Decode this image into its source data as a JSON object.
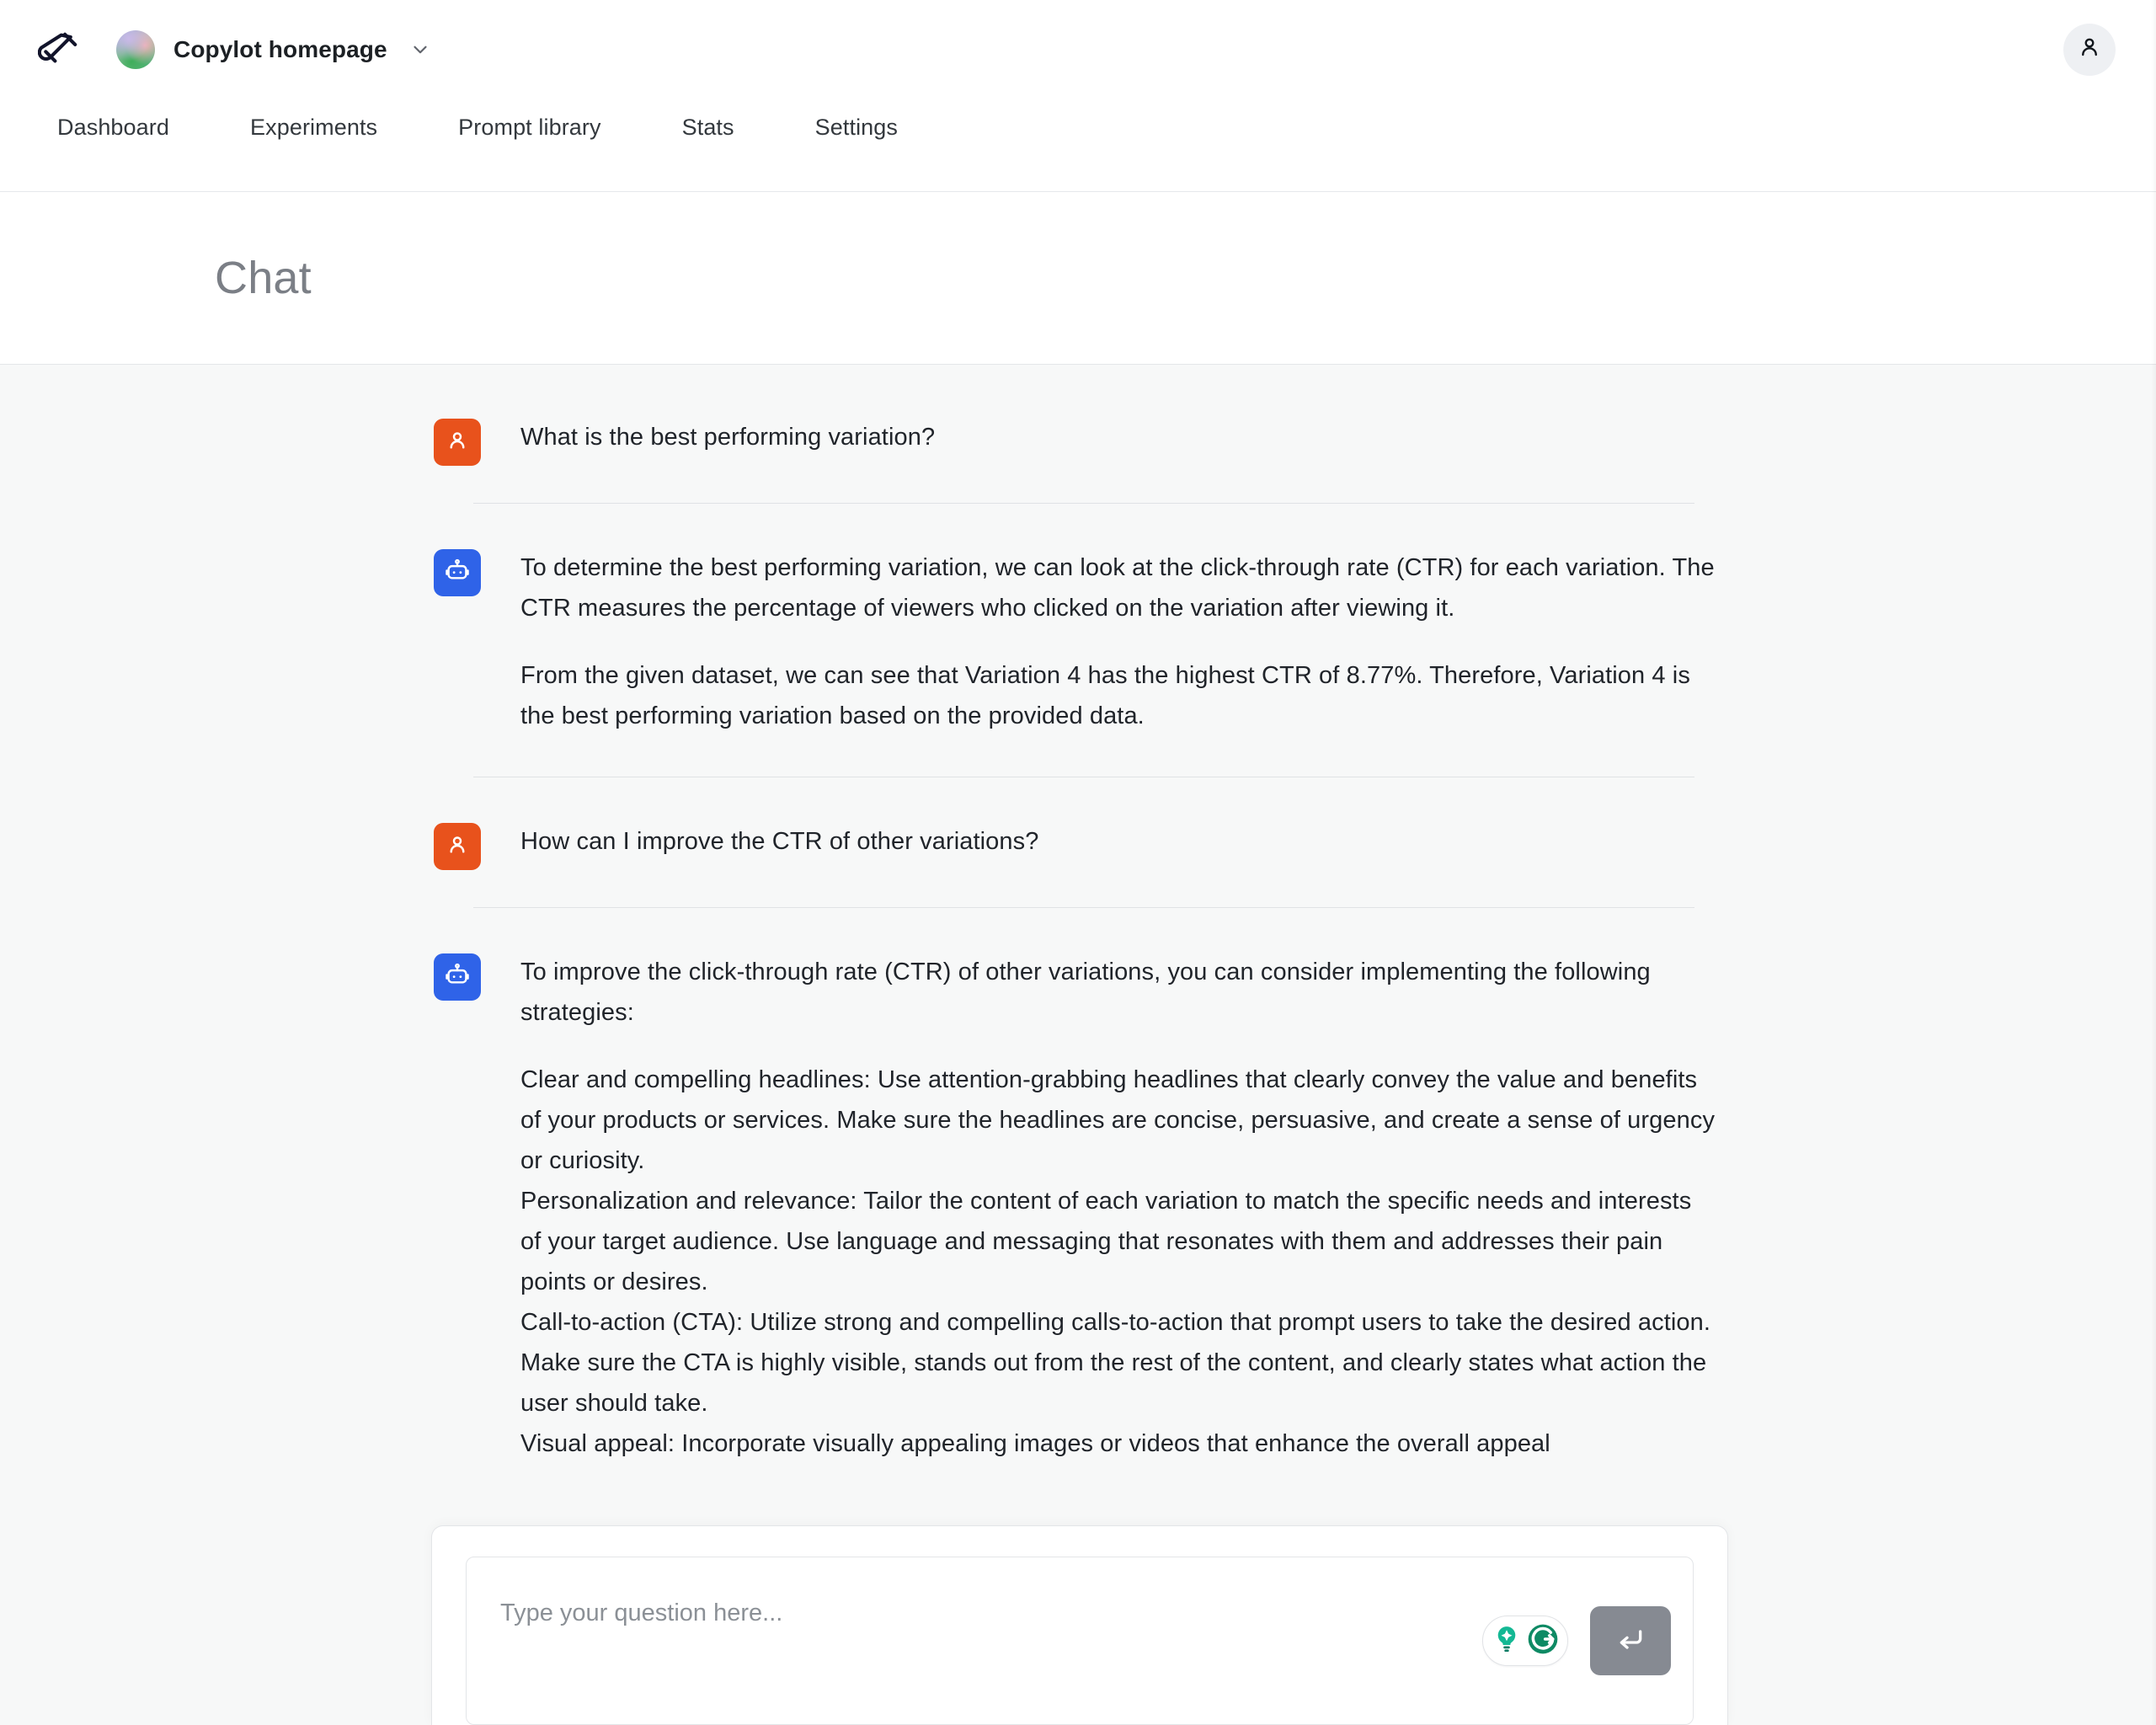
{
  "topbar": {
    "logo_icon": "test-tube-icon",
    "project_name": "Copylot homepage",
    "project_chevron_icon": "chevron-down-icon",
    "account_icon": "person-icon"
  },
  "nav": {
    "items": [
      {
        "label": "Dashboard"
      },
      {
        "label": "Experiments"
      },
      {
        "label": "Prompt library"
      },
      {
        "label": "Stats"
      },
      {
        "label": "Settings"
      }
    ]
  },
  "page": {
    "title": "Chat"
  },
  "chat": {
    "messages": [
      {
        "role": "user",
        "avatar_icon": "person-icon",
        "avatar_color": "#e8521c",
        "paragraphs": [
          "What is the best performing variation?"
        ]
      },
      {
        "role": "assistant",
        "avatar_icon": "robot-icon",
        "avatar_color": "#2f63e8",
        "paragraphs": [
          "To determine the best performing variation, we can look at the click-through rate (CTR) for each variation. The CTR measures the percentage of viewers who clicked on the variation after viewing it.",
          "From the given dataset, we can see that Variation 4 has the highest CTR of 8.77%. Therefore, Variation 4 is the best performing variation based on the provided data."
        ]
      },
      {
        "role": "user",
        "avatar_icon": "person-icon",
        "avatar_color": "#e8521c",
        "paragraphs": [
          "How can I improve the CTR of other variations?"
        ]
      },
      {
        "role": "assistant",
        "avatar_icon": "robot-icon",
        "avatar_color": "#2f63e8",
        "paragraphs": [
          "To improve the click-through rate (CTR) of other variations, you can consider implementing the following strategies:"
        ],
        "strategies": [
          "Clear and compelling headlines: Use attention-grabbing headlines that clearly convey the value and benefits of your products or services. Make sure the headlines are concise, persuasive, and create a sense of urgency or curiosity.",
          "Personalization and relevance: Tailor the content of each variation to match the specific needs and interests of your target audience. Use language and messaging that resonates with them and addresses their pain points or desires.",
          "Call-to-action (CTA): Utilize strong and compelling calls-to-action that prompt users to take the desired action. Make sure the CTA is highly visible, stands out from the rest of the content, and clearly states what action the user should take.",
          "Visual appeal: Incorporate visually appealing images or videos that enhance the overall appeal"
        ]
      }
    ]
  },
  "composer": {
    "placeholder": "Type your question here...",
    "value": "",
    "assist_lightbulb_icon": "lightbulb-sparkle-icon",
    "assist_grammarly_icon": "grammarly-g-icon",
    "send_icon": "enter-return-arrow-icon"
  },
  "colors": {
    "user_avatar": "#e8521c",
    "bot_avatar": "#2f63e8",
    "grammarly_green": "#15c39a",
    "grammarly_dark_green": "#0f8a6a",
    "send_button": "#868a92",
    "page_bg": "#f7f8f8",
    "surface": "#ffffff"
  }
}
